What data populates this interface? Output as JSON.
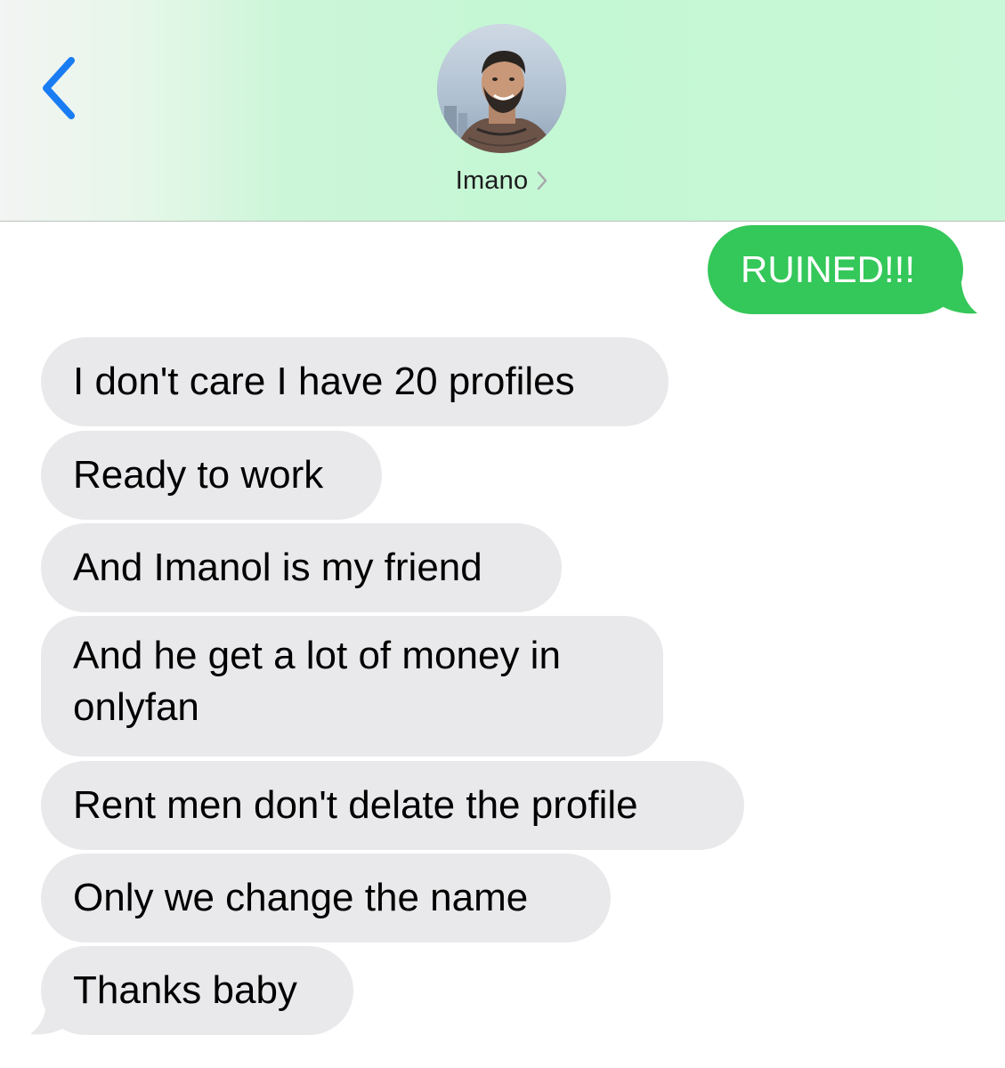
{
  "app": {
    "colors": {
      "back_accent": "#1a7cf3",
      "sent_bubble": "#34c759",
      "received_bubble": "#e9e9eb"
    }
  },
  "header": {
    "back_icon": "chevron-left-icon",
    "contact_name": "Imano",
    "detail_icon": "chevron-right-icon"
  },
  "messages": {
    "sent": [
      {
        "text": "RUINED!!!"
      }
    ],
    "received": [
      {
        "text": "I don't care I have 20 profiles"
      },
      {
        "text": "Ready to work"
      },
      {
        "text": "And Imanol is my friend"
      },
      {
        "line1": "And he get a lot of money in",
        "line2": "onlyfan"
      },
      {
        "text": "Rent men don't delate the profile"
      },
      {
        "text": "Only we change the name"
      },
      {
        "text": "Thanks baby"
      }
    ]
  }
}
